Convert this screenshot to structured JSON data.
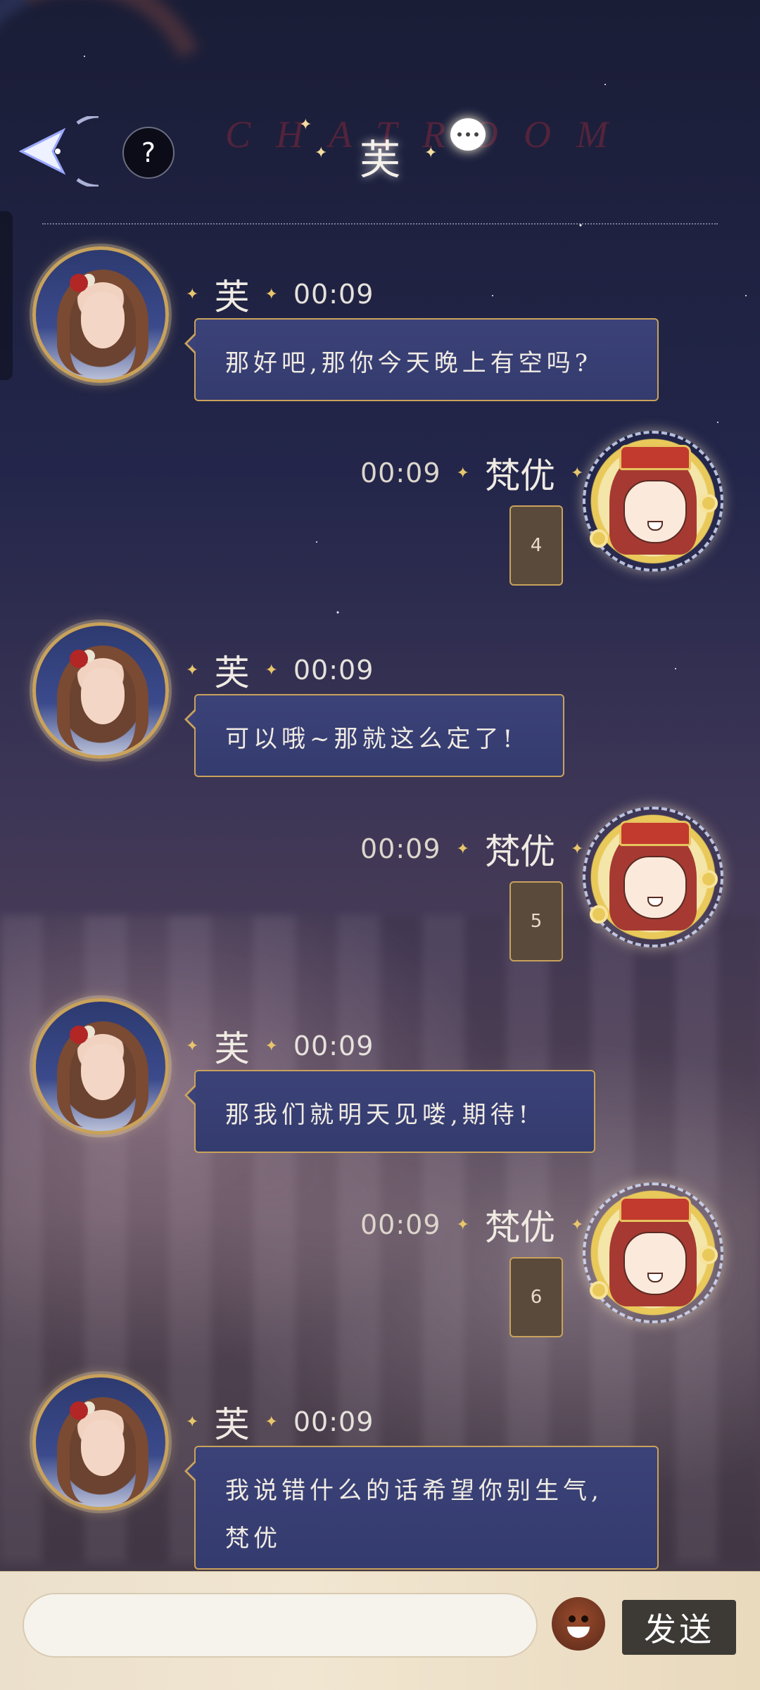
{
  "header": {
    "title": "芙",
    "watermark": "CHATROOM",
    "help_label": "?"
  },
  "input": {
    "placeholder": "",
    "send_label": "发送"
  },
  "messages": [
    {
      "sender": "芙",
      "time": "00:09",
      "text": "那好吧,那你今天晚上有空吗?",
      "side": "left"
    },
    {
      "sender": "梵优",
      "time": "00:09",
      "text": "4",
      "side": "right"
    },
    {
      "sender": "芙",
      "time": "00:09",
      "text": "可以哦~那就这么定了!",
      "side": "left"
    },
    {
      "sender": "梵优",
      "time": "00:09",
      "text": "5",
      "side": "right"
    },
    {
      "sender": "芙",
      "time": "00:09",
      "text": "那我们就明天见喽,期待!",
      "side": "left"
    },
    {
      "sender": "梵优",
      "time": "00:09",
      "text": "6",
      "side": "right"
    },
    {
      "sender": "芙",
      "time": "00:09",
      "text": "我说错什么的话希望你别生气,梵优",
      "side": "left"
    }
  ],
  "colors": {
    "accent_gold": "#c9a25b",
    "bubble_bg": "#3b4278",
    "send_bg": "#3d3a36"
  }
}
